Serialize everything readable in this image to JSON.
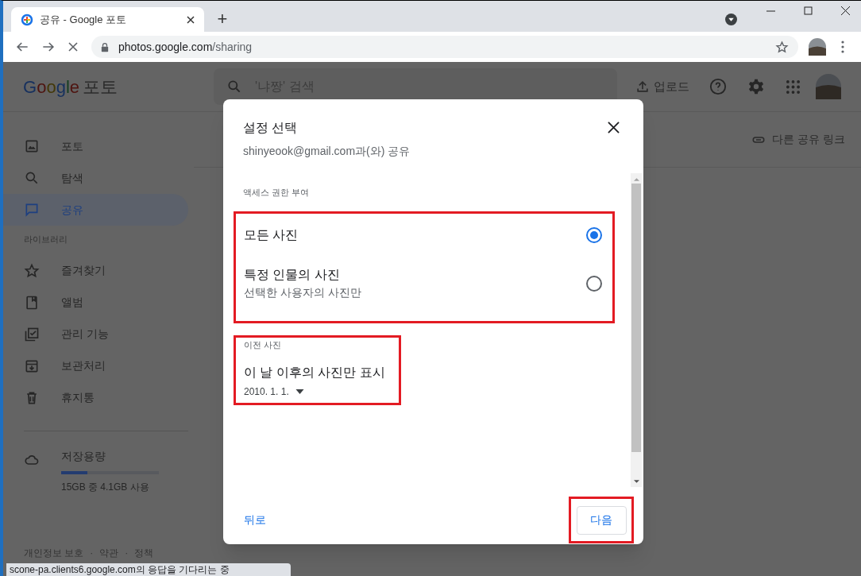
{
  "browser": {
    "tab": {
      "title": "공유 - Google 포토",
      "new_tab": "+"
    },
    "url": {
      "host": "photos.google.com",
      "path": "/sharing"
    }
  },
  "header": {
    "logo": {
      "brand": "Google",
      "product": "포토"
    },
    "search": {
      "placeholder": "'냐짱' 검색"
    },
    "upload": "업로드"
  },
  "sidebar": {
    "items": [
      {
        "label": "포토",
        "selected": false
      },
      {
        "label": "탐색",
        "selected": false
      },
      {
        "label": "공유",
        "selected": true
      }
    ],
    "library_heading": "라이브러리",
    "library_items": [
      {
        "label": "즐겨찾기"
      },
      {
        "label": "앨범"
      },
      {
        "label": "관리 기능"
      },
      {
        "label": "보관처리"
      },
      {
        "label": "휴지통"
      }
    ],
    "storage": {
      "label": "저장용량",
      "level": 0.27,
      "usage": "15GB 중 4.1GB 사용"
    },
    "footer": {
      "links": [
        "개인정보 보호",
        "약관",
        "정책"
      ],
      "separator": "·"
    }
  },
  "share_link": "다른 공유 링크",
  "dialog": {
    "title": "설정 선택",
    "subtitle": "shinyeook@gmail.com과(와) 공유",
    "section": "액세스 권한 부여",
    "options": [
      {
        "label": "모든 사진",
        "selected": true
      },
      {
        "label": "특정 인물의 사진",
        "description": "선택한 사용자의 사진만",
        "selected": false
      }
    ],
    "date": {
      "label": "이전 사진",
      "title": "이 날 이후의 사진만 표시",
      "value": "2010. 1. 1."
    },
    "back": "뒤로",
    "next": "다음"
  },
  "status_bar": "scone-pa.clients6.google.com의 응답을 기다리는 중"
}
